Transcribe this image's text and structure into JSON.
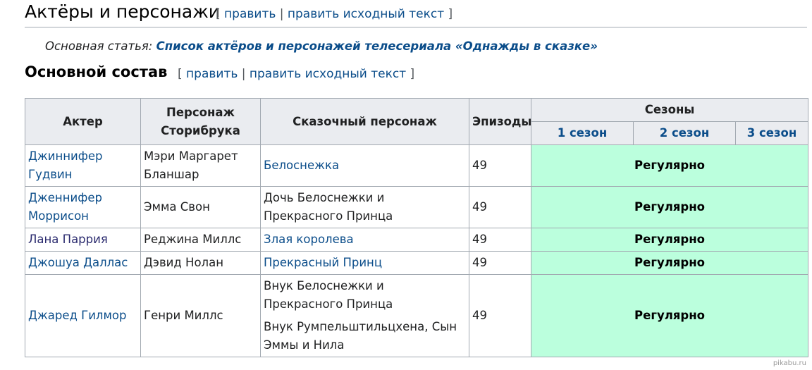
{
  "section": {
    "title": "Актёры и персонажи",
    "edit_open": "[",
    "edit_link": "править",
    "edit_sep": "|",
    "edit_source_link": "править исходный текст",
    "edit_close": "]"
  },
  "hatnote": {
    "prefix": "Основная статья:",
    "link": "Список актёров и персонажей телесериала «Однажды в сказке»"
  },
  "subsection": {
    "title": "Основной состав",
    "edit_open": "[",
    "edit_link": "править",
    "edit_sep": "|",
    "edit_source_link": "править исходный текст",
    "edit_close": "]"
  },
  "table": {
    "headers": {
      "actor": "Актер",
      "storybrooke": "Персонаж Сторибрука",
      "fairytale": "Сказочный персонаж",
      "episodes": "Эпизоды",
      "seasons": "Сезоны"
    },
    "seasons": [
      "1 сезон",
      "2 сезон",
      "3 сезон"
    ],
    "rows": [
      {
        "actor": "Джиннифер Гудвин",
        "storybrooke": "Мэри Маргарет Бланшар",
        "fairytale": [
          "Белоснежка"
        ],
        "episodes": "49",
        "status": "Регулярно"
      },
      {
        "actor": "Дженнифер Моррисон",
        "storybrooke": "Эмма Свон",
        "fairytale": [
          "Дочь Белоснежки и Прекрасного Принца"
        ],
        "episodes": "49",
        "status": "Регулярно"
      },
      {
        "actor": "Лана Паррия",
        "storybrooke": "Реджина Миллс",
        "fairytale": [
          "Злая королева"
        ],
        "episodes": "49",
        "status": "Регулярно"
      },
      {
        "actor": "Джошуа Даллас",
        "storybrooke": "Дэвид Нолан",
        "fairytale": [
          "Прекрасный Принц"
        ],
        "episodes": "49",
        "status": "Регулярно"
      },
      {
        "actor": "Джаред Гилмор",
        "storybrooke": "Генри Миллс",
        "fairytale": [
          "Внук Белоснежки и Прекрасного Принца",
          "Внук Румпельштильцхена, Сын Эммы и Нила"
        ],
        "episodes": "49",
        "status": "Регулярно"
      }
    ]
  },
  "watermark": "pikabu.ru",
  "colors": {
    "link": "#0b4d8a",
    "regular_bg": "#bbffdd",
    "header_bg": "#eaecf0",
    "border": "#a2a9b1"
  }
}
